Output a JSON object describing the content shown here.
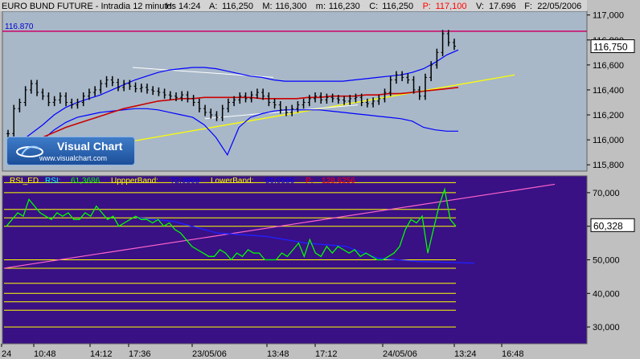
{
  "header": {
    "instrument": "EURO BUND FUTURE - Intradia 12 minutos",
    "fields": [
      {
        "k": "H:",
        "v": "14:24"
      },
      {
        "k": "A:",
        "v": "116,250"
      },
      {
        "k": "M:",
        "v": "116,300"
      },
      {
        "k": "m:",
        "v": "116,230"
      },
      {
        "k": "C:",
        "v": "116,250"
      },
      {
        "k": "P:",
        "v": "117,100",
        "color": "#ff0000"
      },
      {
        "k": "V:",
        "v": "17.696"
      },
      {
        "k": "F:",
        "v": "22/05/2006"
      }
    ]
  },
  "hline_label": "116.870",
  "last_price": "116,750",
  "rsi_last": "60,328",
  "rsi_header": [
    {
      "text": "RSI_ED",
      "color": "#ffff00"
    },
    {
      "text": "RSI:",
      "color": "#00ffff"
    },
    {
      "text": "61,3686",
      "color": "#00ff00"
    },
    {
      "text": "UppperBand:",
      "color": "#ffff00"
    },
    {
      "text": "72,0868",
      "color": "#0000ff"
    },
    {
      "text": "LowerBand:",
      "color": "#ffff00"
    },
    {
      "text": "50,0586",
      "color": "#0000ff"
    },
    {
      "text": "P:",
      "color": "#ff0000"
    },
    {
      "text": "128,6256",
      "color": "#ff0000"
    }
  ],
  "logo": {
    "title": "Visual Chart",
    "url": "www.visualchart.com"
  },
  "colors": {
    "price_bg": "#a8b8c8",
    "rsi_bg": "#3a1085",
    "bars": "#000000",
    "bb_outer": "#0000ff",
    "ma_red": "#cc0000",
    "trend_yellow": "#ffff00",
    "hline_magenta": "#cc0066",
    "rsi_line": "#00ff00",
    "rsi_levels": "#ffff00",
    "rsi_trend": "#ff66cc",
    "band_blue": "#2020ff"
  },
  "chart_data": [
    {
      "type": "candlestick",
      "title": "EURO BUND FUTURE - Intradia 12 minutos",
      "y_ticks": [
        "117,000",
        "116,800",
        "116,600",
        "116,400",
        "116,200",
        "116,000",
        "115,800"
      ],
      "ylim": [
        115.75,
        117.03
      ],
      "horizontal_line": 116.87,
      "x_ticks": [
        "24",
        "10:48",
        "14:12",
        "17:36",
        "23/05/06",
        "13:48",
        "17:12",
        "24/05/06",
        "13:24",
        "16:48"
      ],
      "close_series": [
        116.05,
        116.25,
        116.3,
        116.4,
        116.45,
        116.38,
        116.35,
        116.3,
        116.32,
        116.35,
        116.3,
        116.28,
        116.3,
        116.35,
        116.38,
        116.4,
        116.45,
        116.48,
        116.46,
        116.42,
        116.45,
        116.43,
        116.41,
        116.42,
        116.4,
        116.39,
        116.38,
        116.36,
        116.35,
        116.34,
        116.36,
        116.33,
        116.3,
        116.25,
        116.22,
        116.2,
        116.18,
        116.25,
        116.3,
        116.32,
        116.35,
        116.33,
        116.36,
        116.38,
        116.35,
        116.3,
        116.28,
        116.24,
        116.22,
        116.25,
        116.28,
        116.3,
        116.33,
        116.35,
        116.32,
        116.34,
        116.33,
        116.32,
        116.31,
        116.33,
        116.34,
        116.3,
        116.29,
        116.31,
        116.33,
        116.38,
        116.48,
        116.52,
        116.5,
        116.48,
        116.4,
        116.35,
        116.5,
        116.6,
        116.7,
        116.85,
        116.78,
        116.75
      ],
      "series": [
        {
          "name": "upper band",
          "values": [
            115.92,
            115.98,
            116.05,
            116.12,
            116.2,
            116.26,
            116.3,
            116.33,
            116.36,
            116.4,
            116.44,
            116.48,
            116.51,
            116.54,
            116.56,
            116.57,
            116.58,
            116.58,
            116.57,
            116.55,
            116.53,
            116.51,
            116.5,
            116.48,
            116.47,
            116.47,
            116.47,
            116.47,
            116.47,
            116.47,
            116.48,
            116.49,
            116.5,
            116.51,
            116.52,
            116.54,
            116.57,
            116.62,
            116.68,
            116.72
          ]
        },
        {
          "name": "lower band",
          "values": [
            115.8,
            115.85,
            115.92,
            116.0,
            116.08,
            116.14,
            116.18,
            116.2,
            116.22,
            116.23,
            116.24,
            116.25,
            116.25,
            116.24,
            116.22,
            116.2,
            116.18,
            116.12,
            116.02,
            115.88,
            116.1,
            116.18,
            116.21,
            116.23,
            116.24,
            116.24,
            116.24,
            116.24,
            116.23,
            116.22,
            116.21,
            116.2,
            116.19,
            116.18,
            116.17,
            116.15,
            116.1,
            116.08,
            116.07,
            116.07
          ]
        },
        {
          "name": "red average",
          "values": [
            115.9,
            115.94,
            115.98,
            116.02,
            116.06,
            116.1,
            116.13,
            116.16,
            116.19,
            116.22,
            116.25,
            116.27,
            116.29,
            116.31,
            116.32,
            116.33,
            116.33,
            116.34,
            116.34,
            116.34,
            116.34,
            116.34,
            116.33,
            116.33,
            116.33,
            116.33,
            116.34,
            116.34,
            116.35,
            116.35,
            116.35,
            116.36,
            116.36,
            116.37,
            116.37,
            116.38,
            116.39,
            116.4,
            116.41,
            116.42
          ]
        }
      ],
      "yellow_trendline": [
        [
          0,
          115.85
        ],
        [
          1,
          116.52
        ]
      ]
    },
    {
      "type": "line",
      "title": "RSI_ED",
      "y_ticks": [
        "70,000",
        "60,000",
        "50,000",
        "40,000",
        "30,000"
      ],
      "ylim": [
        25,
        75
      ],
      "levels": [
        73,
        70,
        65,
        62.5,
        60,
        50,
        47.5,
        43,
        40,
        37.5,
        35,
        30
      ],
      "rsi": [
        60,
        62,
        64,
        63,
        68,
        66,
        64,
        63,
        62,
        64,
        63,
        64,
        62,
        62,
        64,
        63,
        66,
        64,
        62,
        63,
        60,
        61,
        62,
        63,
        62,
        62,
        61,
        62,
        60,
        61,
        59,
        58,
        56,
        54,
        53,
        52,
        51,
        51,
        53,
        52,
        50,
        52,
        51,
        53,
        52,
        52,
        50,
        50,
        50,
        52,
        51,
        53,
        55,
        51,
        56,
        52,
        51,
        54,
        52,
        54,
        53,
        52,
        53,
        51,
        52,
        51,
        50,
        50,
        51,
        52,
        54,
        59,
        62,
        61,
        63,
        52,
        59,
        66,
        71,
        62,
        60
      ]
    }
  ]
}
